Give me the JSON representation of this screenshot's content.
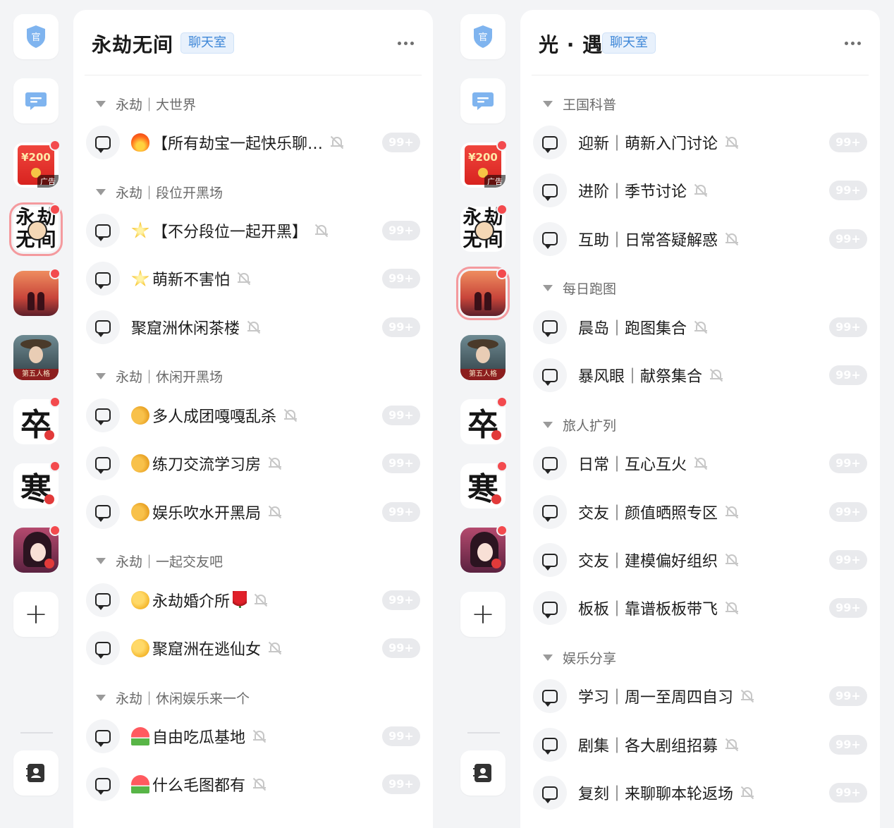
{
  "colors": {
    "background": "#f3f4f6",
    "badge_bg": "#e8f1fc",
    "badge_text": "#3e87d8",
    "unread_dot": "#f34a4e",
    "count_pill": "#e9eaed"
  },
  "screens": [
    {
      "rail": {
        "official_icon_text": "官",
        "ad_amount": "¥200",
        "ad_label": "广告",
        "app_chars_1": [
          "永",
          "劫",
          "无",
          "间"
        ],
        "app_text_fifth": "第五人格",
        "app_char_ink1": "卒",
        "app_char_ink2": "寒",
        "add_symbol": "+"
      },
      "title": "永劫无间",
      "badge": "聊天室",
      "categories": [
        {
          "name": "永劫｜大世界",
          "channels": [
            {
              "emoji": "fire",
              "name": "【所有劫宝一起快乐聊…",
              "count": "99+"
            }
          ]
        },
        {
          "name": "永劫｜段位开黑场",
          "channels": [
            {
              "emoji": "star",
              "name": "【不分段位一起开黑】",
              "count": "99+"
            },
            {
              "emoji": "star",
              "name": "萌新不害怕",
              "count": "99+"
            },
            {
              "emoji": "",
              "name": "聚窟洲休闲茶楼",
              "count": "99+"
            }
          ]
        },
        {
          "name": "永劫｜休闲开黑场",
          "channels": [
            {
              "emoji": "hands",
              "name": "多人成团嘎嘎乱杀",
              "count": "99+"
            },
            {
              "emoji": "hands",
              "name": "练刀交流学习房",
              "count": "99+"
            },
            {
              "emoji": "hands",
              "name": "娱乐吹水开黑局",
              "count": "99+"
            }
          ]
        },
        {
          "name": "永劫｜一起交友吧",
          "channels": [
            {
              "emoji": "wink",
              "name": "永劫婚介所",
              "suffix": "rose",
              "count": "99+"
            },
            {
              "emoji": "wink",
              "name": "聚窟洲在逃仙女",
              "count": "99+"
            }
          ]
        },
        {
          "name": "永劫｜休闲娱乐来一个",
          "channels": [
            {
              "emoji": "melon",
              "name": "自由吃瓜基地",
              "count": "99+"
            },
            {
              "emoji": "melon",
              "name": "什么毛图都有",
              "count": "99+"
            }
          ]
        }
      ]
    },
    {
      "rail": {
        "official_icon_text": "官",
        "ad_amount": "¥200",
        "ad_label": "广告",
        "app_chars_1": [
          "永",
          "劫",
          "无",
          "间"
        ],
        "app_text_fifth": "第五人格",
        "app_char_ink1": "卒",
        "app_char_ink2": "寒",
        "add_symbol": "+"
      },
      "title": "光 · 遇",
      "badge": "聊天室",
      "categories": [
        {
          "name": "王国科普",
          "channels": [
            {
              "emoji": "",
              "name": "迎新｜萌新入门讨论",
              "count": "99+"
            },
            {
              "emoji": "",
              "name": "进阶｜季节讨论",
              "count": "99+"
            },
            {
              "emoji": "",
              "name": "互助｜日常答疑解惑",
              "count": "99+"
            }
          ]
        },
        {
          "name": "每日跑图",
          "channels": [
            {
              "emoji": "",
              "name": "晨岛｜跑图集合",
              "count": "99+"
            },
            {
              "emoji": "",
              "name": "暴风眼｜献祭集合",
              "count": "99+"
            }
          ]
        },
        {
          "name": "旅人扩列",
          "channels": [
            {
              "emoji": "",
              "name": "日常｜互心互火",
              "count": "99+"
            },
            {
              "emoji": "",
              "name": "交友｜颜值晒照专区",
              "count": "99+"
            },
            {
              "emoji": "",
              "name": "交友｜建模偏好组织",
              "count": "99+"
            },
            {
              "emoji": "",
              "name": "板板｜靠谱板板带飞",
              "count": "99+"
            }
          ]
        },
        {
          "name": "娱乐分享",
          "channels": [
            {
              "emoji": "",
              "name": "学习｜周一至周四自习",
              "count": "99+"
            },
            {
              "emoji": "",
              "name": "剧集｜各大剧组招募",
              "count": "99+"
            },
            {
              "emoji": "",
              "name": "复刻｜来聊聊本轮返场",
              "count": "99+"
            }
          ]
        }
      ]
    }
  ]
}
